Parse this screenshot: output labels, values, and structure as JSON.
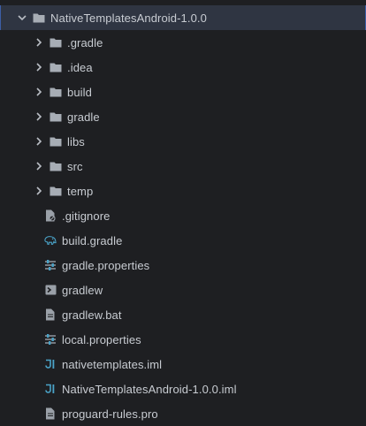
{
  "root": {
    "label": "NativeTemplatesAndroid-1.0.0",
    "icon": "folder-icon",
    "expanded": true
  },
  "folders": [
    {
      "label": ".gradle",
      "icon": "folder-icon"
    },
    {
      "label": ".idea",
      "icon": "folder-icon"
    },
    {
      "label": "build",
      "icon": "folder-icon"
    },
    {
      "label": "gradle",
      "icon": "folder-icon"
    },
    {
      "label": "libs",
      "icon": "folder-icon"
    },
    {
      "label": "src",
      "icon": "folder-icon"
    },
    {
      "label": "temp",
      "icon": "folder-icon"
    }
  ],
  "files": [
    {
      "label": ".gitignore",
      "icon": "gitignore-file-icon"
    },
    {
      "label": "build.gradle",
      "icon": "gradle-elephant-icon"
    },
    {
      "label": "gradle.properties",
      "icon": "properties-file-icon"
    },
    {
      "label": "gradlew",
      "icon": "shell-script-icon"
    },
    {
      "label": "gradlew.bat",
      "icon": "text-file-icon"
    },
    {
      "label": "local.properties",
      "icon": "properties-file-icon"
    },
    {
      "label": "nativetemplates.iml",
      "icon": "iml-module-icon"
    },
    {
      "label": "NativeTemplatesAndroid-1.0.0.iml",
      "icon": "iml-module-icon"
    },
    {
      "label": "proguard-rules.pro",
      "icon": "text-file-icon"
    }
  ],
  "colors": {
    "background": "#1e1f22",
    "selection": "#2f3542",
    "selection_border": "#3c5ea6",
    "folder": "#a7adb5",
    "accent_teal": "#4aa3c8",
    "text": "#c8ccd2"
  }
}
